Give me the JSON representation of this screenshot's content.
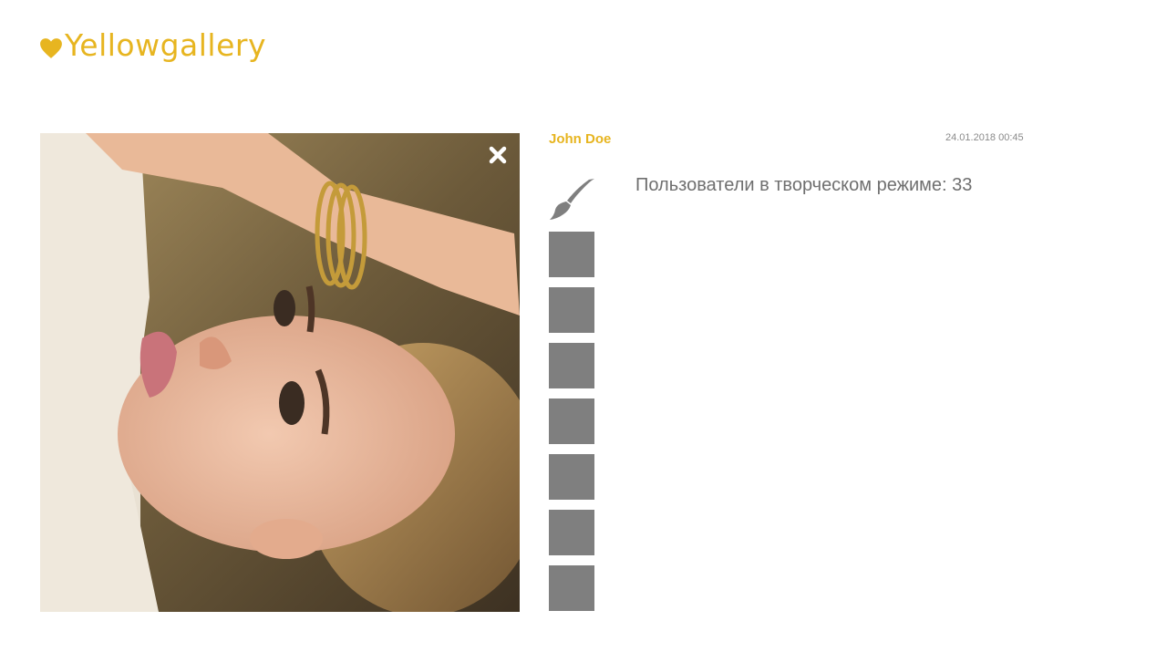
{
  "header": {
    "logo_text": "Yellowgallery",
    "logo_icon": "heart-icon",
    "accent_color": "#e7b520"
  },
  "photo": {
    "alt": "photo",
    "close_icon": "close-icon"
  },
  "post": {
    "author": "John Doe",
    "timestamp": "24.01.2018 00:45",
    "status_text": "Пользователи в творческом режиме: 33"
  },
  "tools": {
    "brush_icon": "paintbrush-icon",
    "swatch_color": "#7f7f7f",
    "swatch_count": 7
  }
}
